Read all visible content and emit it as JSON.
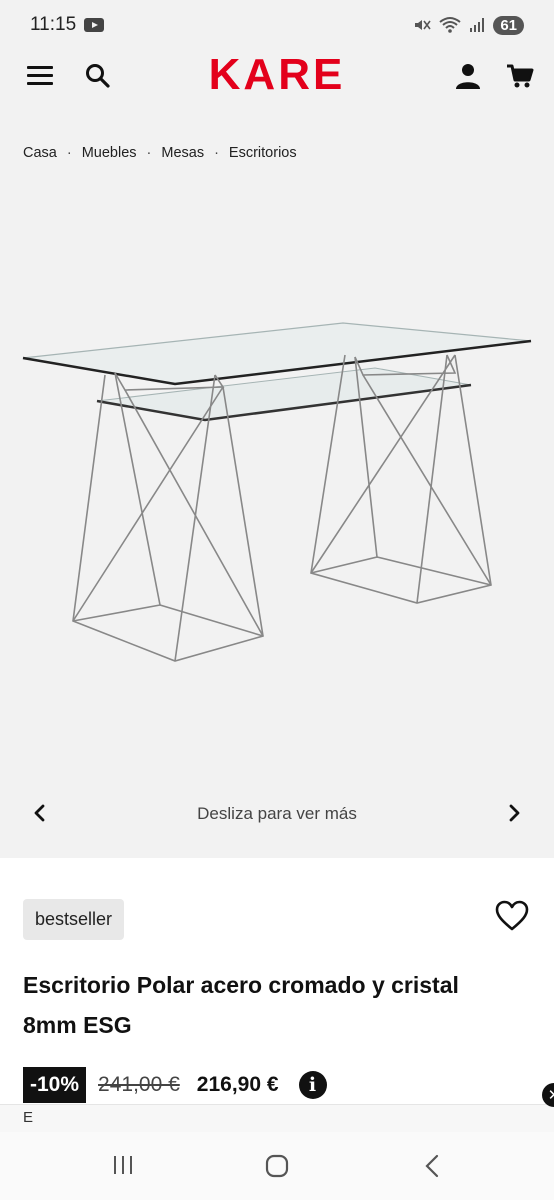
{
  "status_bar": {
    "time": "11:15",
    "battery": "61"
  },
  "header": {
    "logo": "KARE"
  },
  "breadcrumb": {
    "items": [
      "Casa",
      "Muebles",
      "Mesas",
      "Escritorios"
    ],
    "separator": "·"
  },
  "gallery": {
    "hint": "Desliza para ver más"
  },
  "product": {
    "badge": "bestseller",
    "title": "Escritorio Polar acero cromado y cristal 8mm ESG",
    "discount": "-10%",
    "old_price": "241,00 €",
    "new_price": "216,90 €",
    "info_glyph": "i"
  },
  "popup": {
    "letter": "E",
    "close_glyph": "✕"
  },
  "colors": {
    "brand": "#e3001b",
    "background": "#f2f2f2",
    "text": "#111111"
  },
  "icons": [
    "menu-icon",
    "search-icon",
    "user-icon",
    "cart-icon",
    "chevron-left-icon",
    "chevron-right-icon",
    "heart-icon",
    "info-icon",
    "recent-apps-icon",
    "home-icon",
    "back-icon"
  ]
}
